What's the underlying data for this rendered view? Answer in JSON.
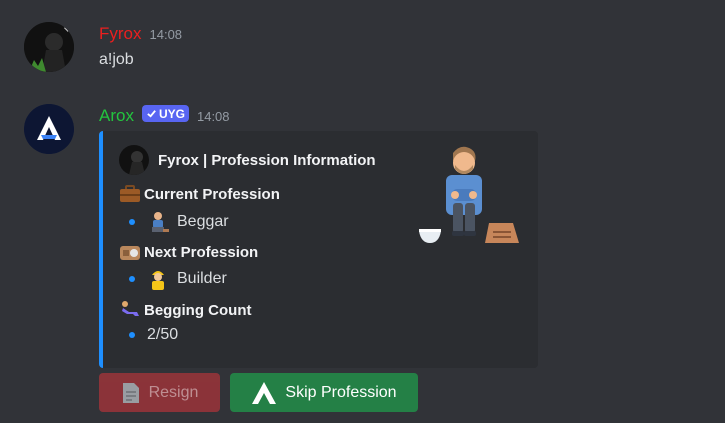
{
  "messages": [
    {
      "username": "Fyrox",
      "username_color": "#ea1f1f",
      "timestamp": "14:08",
      "content": "a!job",
      "avatar_icon": "dark-silhouette-avatar"
    },
    {
      "username": "Arox",
      "username_color": "#23c43e",
      "bot_tag": "UYG",
      "timestamp": "14:08",
      "avatar_icon": "arox-logo-avatar",
      "embed": {
        "accent_color": "#1e8fff",
        "author": "Fyrox | Profession Information",
        "thumbnail_icon": "beggar-sitting-illustration",
        "fields": [
          {
            "name": "Current Profession",
            "name_icon": "briefcase-icon",
            "value": "Beggar",
            "value_icon": "beggar-emoji-icon"
          },
          {
            "name": "Next Profession",
            "name_icon": "radio-icon",
            "value": "Builder",
            "value_icon": "construction-worker-icon"
          },
          {
            "name": "Begging Count",
            "name_icon": "sitting-person-icon",
            "value": "2/50"
          }
        ]
      },
      "buttons": [
        {
          "label": "Resign",
          "icon": "document-icon",
          "style": "danger-disabled"
        },
        {
          "label": "Skip Profession",
          "icon": "chevron-up-icon",
          "style": "success"
        }
      ]
    }
  ]
}
